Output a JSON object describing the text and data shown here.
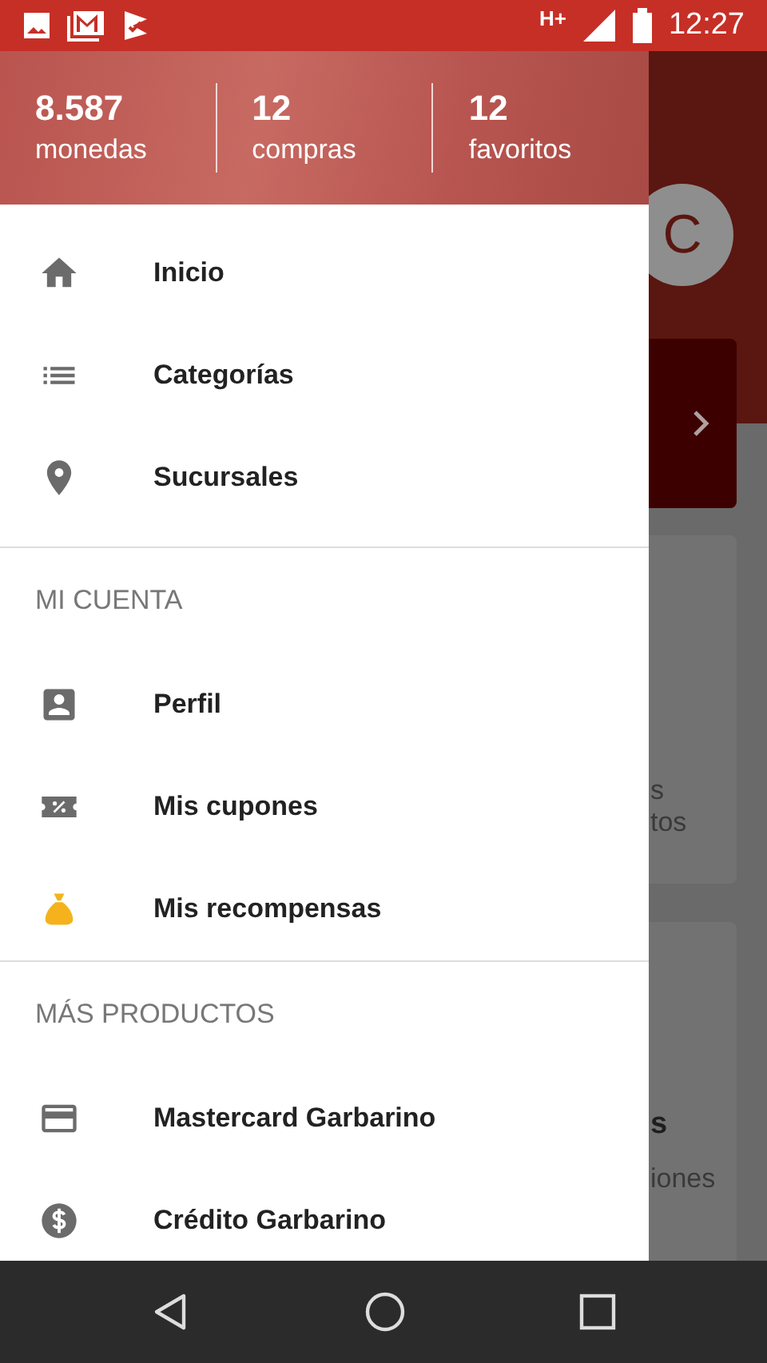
{
  "status_bar": {
    "network": "H+",
    "time": "12:27"
  },
  "stats": [
    {
      "value": "8.587",
      "label": "monedas"
    },
    {
      "value": "12",
      "label": "compras"
    },
    {
      "value": "12",
      "label": "favoritos"
    }
  ],
  "sections": [
    {
      "items": [
        {
          "kind": "home",
          "label": "Inicio"
        },
        {
          "kind": "list",
          "label": "Categorías"
        },
        {
          "kind": "pin",
          "label": "Sucursales"
        }
      ]
    },
    {
      "title": "MI CUENTA",
      "items": [
        {
          "kind": "person",
          "label": "Perfil"
        },
        {
          "kind": "coupon",
          "label": "Mis cupones"
        },
        {
          "kind": "bag",
          "label": "Mis recompensas"
        }
      ]
    },
    {
      "title": "MÁS PRODUCTOS",
      "items": [
        {
          "kind": "card",
          "label": "Mastercard Garbarino"
        },
        {
          "kind": "dollar",
          "label": "Crédito Garbarino"
        }
      ]
    }
  ],
  "background": {
    "avatar_letter": "C",
    "card_1_lines": [
      "s",
      "tos"
    ],
    "card_2_title": "s",
    "card_2_text": "iones"
  }
}
